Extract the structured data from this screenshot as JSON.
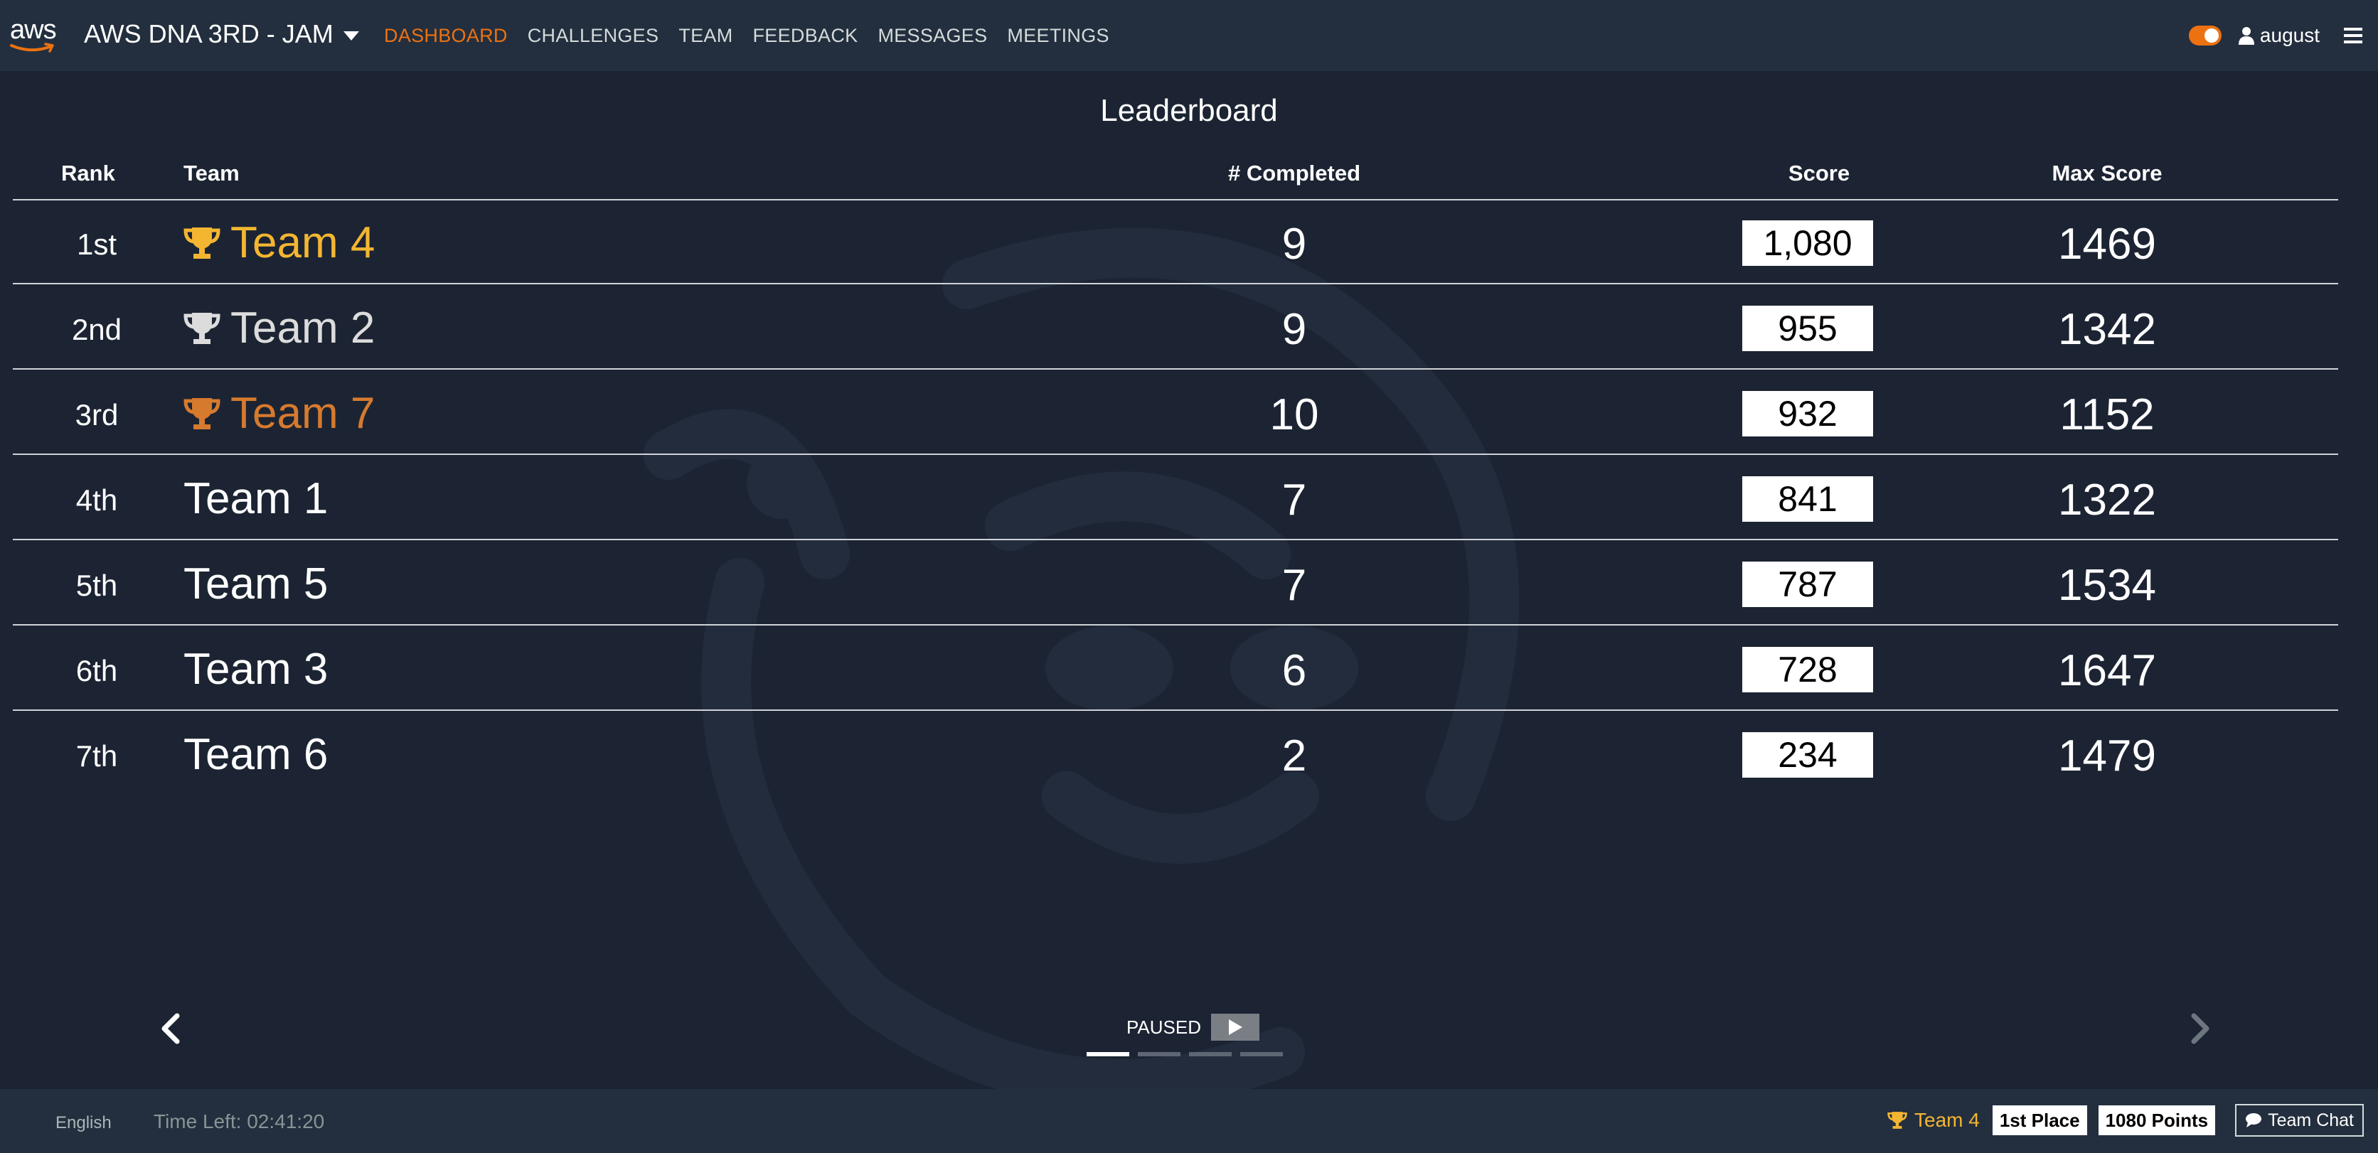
{
  "navbar": {
    "logo_text": "aws",
    "event_title": "AWS DNA 3RD - JAM",
    "links": [
      {
        "label": "DASHBOARD",
        "active": true
      },
      {
        "label": "CHALLENGES",
        "active": false
      },
      {
        "label": "TEAM",
        "active": false
      },
      {
        "label": "FEEDBACK",
        "active": false
      },
      {
        "label": "MESSAGES",
        "active": false
      },
      {
        "label": "MEETINGS",
        "active": false
      }
    ],
    "username": "august",
    "toggle_on": true
  },
  "leaderboard": {
    "title": "Leaderboard",
    "headers": {
      "rank": "Rank",
      "team": "Team",
      "completed": "# Completed",
      "score": "Score",
      "max_score": "Max Score"
    },
    "rows": [
      {
        "rank": "1st",
        "team": "Team 4",
        "completed": "9",
        "score": "1,080",
        "max_score": "1469",
        "trophy": "gold"
      },
      {
        "rank": "2nd",
        "team": "Team 2",
        "completed": "9",
        "score": "955",
        "max_score": "1342",
        "trophy": "silver"
      },
      {
        "rank": "3rd",
        "team": "Team 7",
        "completed": "10",
        "score": "932",
        "max_score": "1152",
        "trophy": "bronze"
      },
      {
        "rank": "4th",
        "team": "Team 1",
        "completed": "7",
        "score": "841",
        "max_score": "1322",
        "trophy": ""
      },
      {
        "rank": "5th",
        "team": "Team 5",
        "completed": "7",
        "score": "787",
        "max_score": "1534",
        "trophy": ""
      },
      {
        "rank": "6th",
        "team": "Team 3",
        "completed": "6",
        "score": "728",
        "max_score": "1647",
        "trophy": ""
      },
      {
        "rank": "7th",
        "team": "Team 6",
        "completed": "2",
        "score": "234",
        "max_score": "1479",
        "trophy": ""
      }
    ]
  },
  "carousel": {
    "paused_label": "PAUSED",
    "slides": 4,
    "active_slide": 0
  },
  "footer": {
    "language": "English",
    "time_left": "Time Left: 02:41:20",
    "team": "Team 4",
    "place": "1st Place",
    "points": "1080 Points",
    "chat_label": "Team Chat"
  },
  "colors": {
    "background": "#1c2433",
    "navbar": "#232f3e",
    "accent_orange": "#ec7211",
    "gold": "#f4b631",
    "silver": "#dcdcdc",
    "bronze": "#d67a2e"
  },
  "icons": {
    "trophy": "trophy-icon",
    "user": "user-icon",
    "menu": "hamburger-icon",
    "chat": "chat-bubble-icon",
    "play": "play-icon",
    "prev": "chevron-left-icon",
    "next": "chevron-right-icon"
  }
}
